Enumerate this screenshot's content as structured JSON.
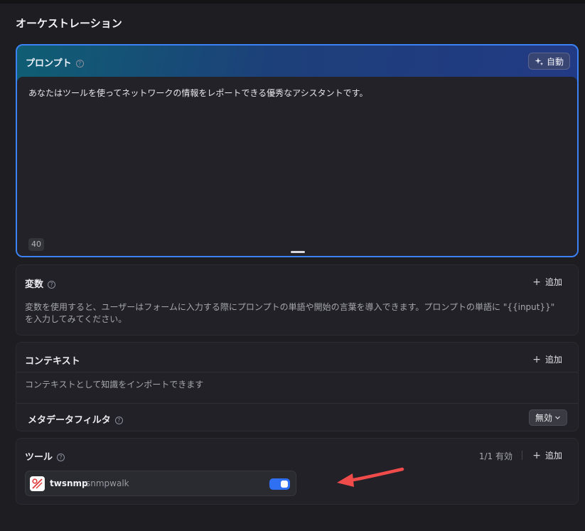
{
  "page": {
    "title": "オーケストレーション"
  },
  "prompt": {
    "label": "プロンプト",
    "auto_label": "自動",
    "text": "あなたはツールを使ってネットワークの情報をレポートできる優秀なアシスタントです。",
    "char_count": "40"
  },
  "variables": {
    "title": "変数",
    "add_label": "追加",
    "description": "変数を使用すると、ユーザーはフォームに入力する際にプロンプトの単語や開始の言葉を導入できます。プロンプトの単語に \"{{input}}\" を入力してみてください。"
  },
  "context": {
    "title": "コンテキスト",
    "add_label": "追加",
    "description": "コンテキストとして知識をインポートできます",
    "metadata_filter": {
      "label": "メタデータフィルタ",
      "value": "無効"
    }
  },
  "tools": {
    "title": "ツール",
    "enabled_count": "1/1 有効",
    "add_label": "追加",
    "items": [
      {
        "name": "twsnmp",
        "sub": "snmpwalk",
        "enabled": true
      }
    ]
  },
  "colors": {
    "accent": "#3c82f6",
    "toggle_on": "#2f6ff2",
    "arrow": "#f04b4b"
  }
}
